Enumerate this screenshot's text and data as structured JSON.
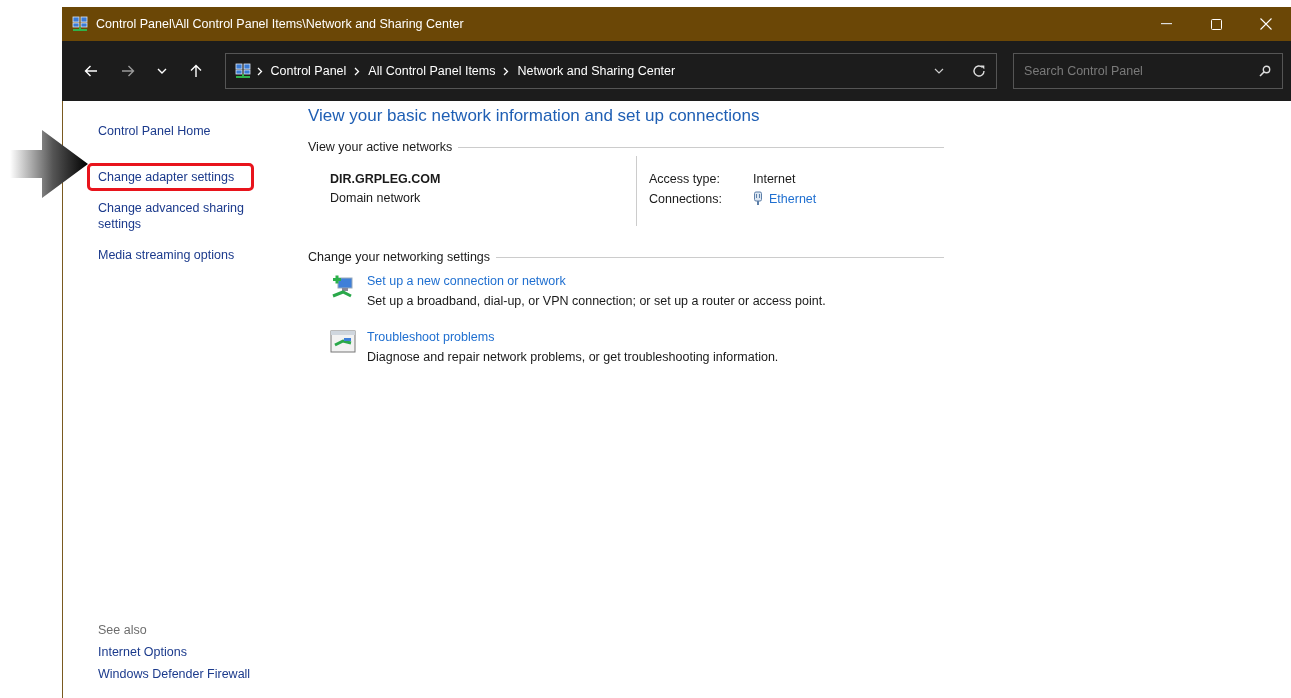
{
  "window": {
    "title": "Control Panel\\All Control Panel Items\\Network and Sharing Center"
  },
  "address_bar": {
    "breadcrumbs": [
      "Control Panel",
      "All Control Panel Items",
      "Network and Sharing Center"
    ]
  },
  "search": {
    "placeholder": "Search Control Panel"
  },
  "sidebar": {
    "items": [
      {
        "label": "Control Panel Home",
        "highlighted": false
      },
      {
        "label": "Change adapter settings",
        "highlighted": true
      },
      {
        "label": "Change advanced sharing settings",
        "highlighted": false
      },
      {
        "label": "Media streaming options",
        "highlighted": false
      }
    ],
    "see_also": {
      "heading": "See also",
      "links": [
        "Internet Options",
        "Windows Defender Firewall"
      ]
    }
  },
  "main": {
    "heading": "View your basic network information and set up connections",
    "active_networks": {
      "heading": "View your active networks",
      "network_name": "DIR.GRPLEG.COM",
      "network_type": "Domain network",
      "access_type_label": "Access type:",
      "access_type": "Internet",
      "connections_label": "Connections:",
      "connection": "Ethernet"
    },
    "settings": {
      "heading": "Change your networking settings",
      "tasks": [
        {
          "kind": "new-connection",
          "title": "Set up a new connection or network",
          "description": "Set up a broadband, dial-up, or VPN connection; or set up a router or access point."
        },
        {
          "kind": "troubleshoot",
          "title": "Troubleshoot problems",
          "description": "Diagnose and repair network problems, or get troubleshooting information."
        }
      ]
    }
  }
}
